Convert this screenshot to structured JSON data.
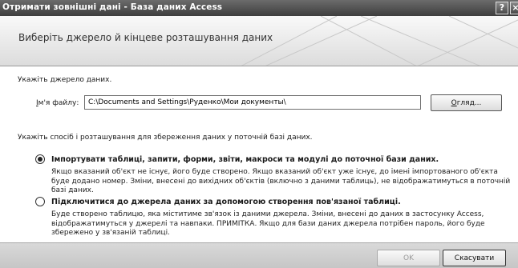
{
  "window": {
    "title": "Отримати зовнішні дані - База даних Access",
    "help_label": "?",
    "close_label": "×"
  },
  "header": {
    "title": "Виберіть джерело й кінцеве розташування даних"
  },
  "source": {
    "heading": "Укажіть джерело даних.",
    "file_label_prefix": "І",
    "file_label_rest": "м'я файлу:",
    "file_value": "C:\\Documents and Settings\\Руденко\\Мои документы\\",
    "browse_label_underlined": "О",
    "browse_label_rest": "гляд..."
  },
  "storage": {
    "heading": "Укажіть спосіб і розташування для збереження даних у поточній базі даних.",
    "options": [
      {
        "label": "Імпортувати таблиці, запити, форми, звіти, макроси та модулі до поточної бази даних.",
        "description": "Якщо вказаний об'єкт не існує, його буде створено. Якщо вказаний об'єкт уже існує, до імені імпортованого об'єкта буде додано номер. Зміни, внесені до вихідних об'єктів (включно з даними таблиць), не відображатимуться в поточній базі даних.",
        "checked": true
      },
      {
        "label": "Підключитися до джерела даних за допомогою створення пов'язаної таблиці.",
        "description": "Буде створено таблицю, яка міститиме зв'язок із даними джерела. Зміни, внесені до даних в застосунку Access, відображатимуться у джерелі та навпаки. ПРИМІТКА. Якщо для бази даних джерела потрібен пароль, його буде збережено у зв'язаній таблиці.",
        "checked": false
      }
    ]
  },
  "footer": {
    "ok_label": "OK",
    "cancel_label": "Скасувати"
  }
}
